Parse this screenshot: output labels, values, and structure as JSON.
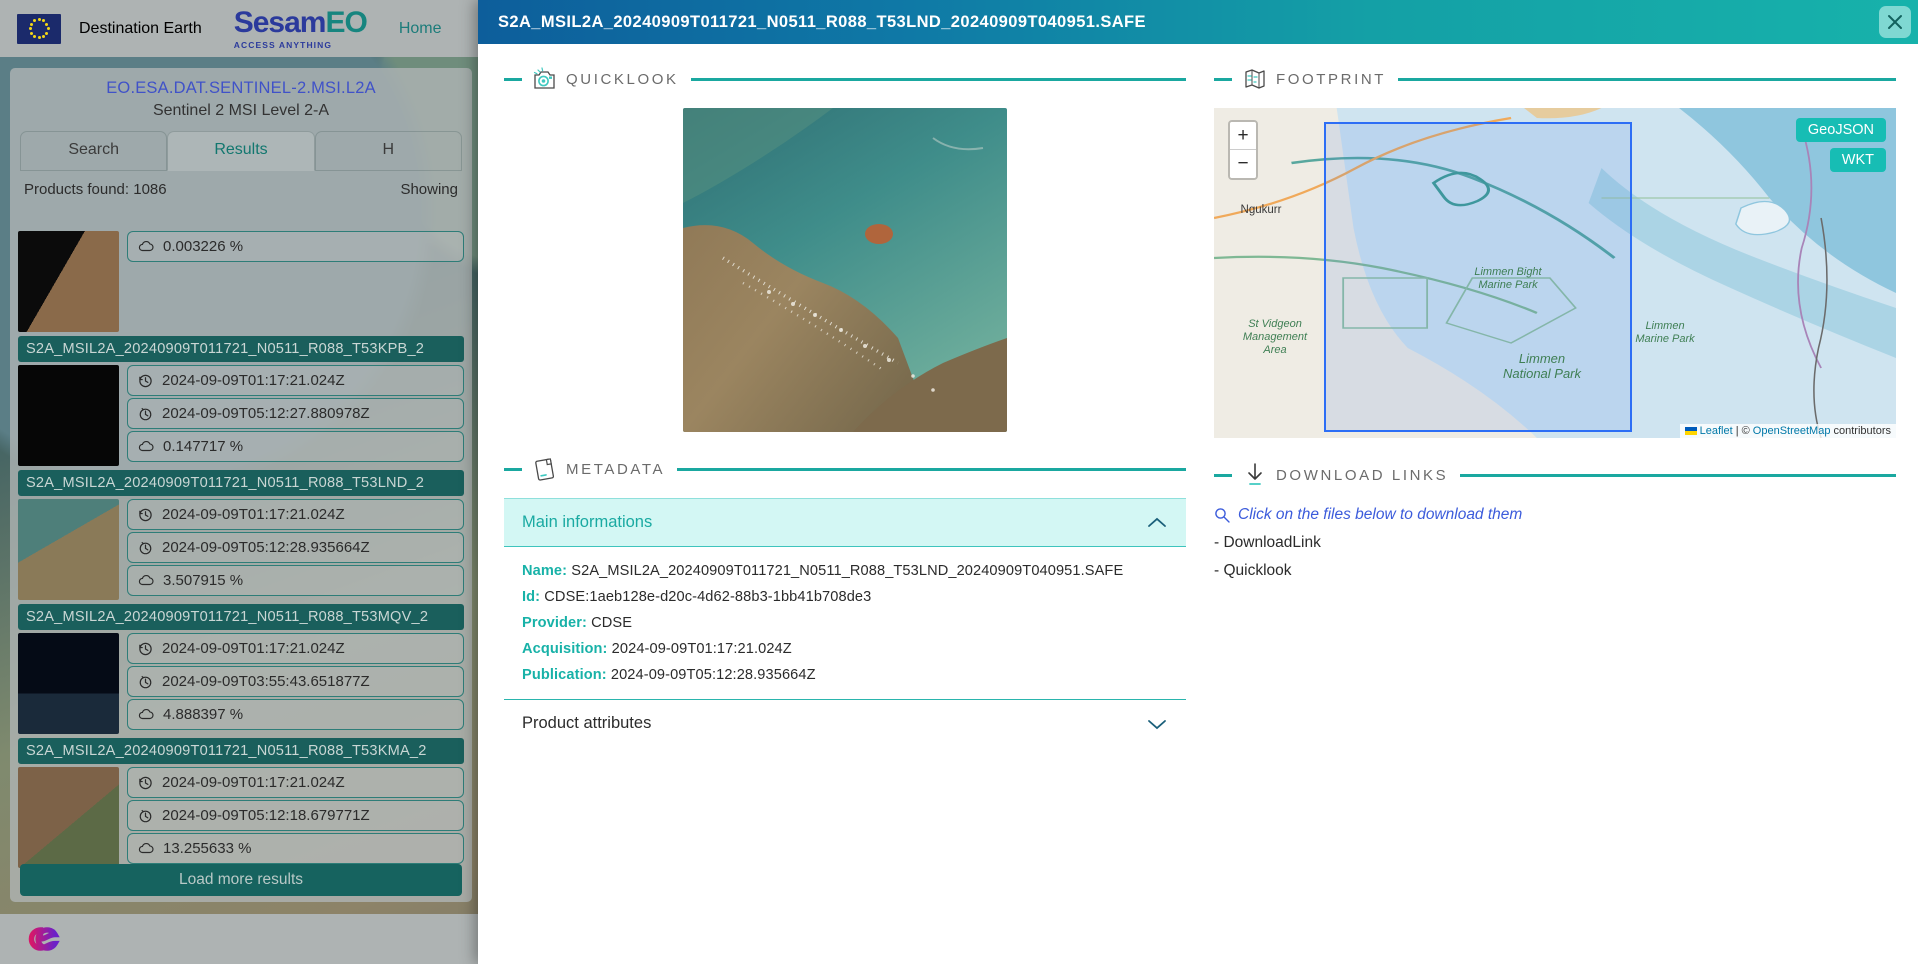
{
  "background": {
    "brand_title": "Destination Earth",
    "logo_word_a": "Sesam",
    "logo_word_b": "EO",
    "logo_tagline": "ACCESS ANYTHING",
    "nav": [
      {
        "label": "Home"
      }
    ],
    "collection_id": "EO.ESA.DAT.SENTINEL-2.MSI.L2A",
    "collection_name": "Sentinel 2 MSI Level 2-A",
    "tabs": [
      {
        "label": "Search",
        "active": false
      },
      {
        "label": "Results",
        "active": true
      },
      {
        "label": "H",
        "active": false
      }
    ],
    "products_found": "Products found: 1086",
    "showing": "Showing",
    "load_more_label": "Load more results",
    "results": [
      {
        "title": "",
        "rows": [
          {
            "icon": "cloud-icon",
            "value": "0.003226 %"
          }
        ]
      },
      {
        "title": "S2A_MSIL2A_20240909T011721_N0511_R088_T53KPB_2",
        "rows": [
          {
            "icon": "clock-back-icon",
            "value": "2024-09-09T01:17:21.024Z"
          },
          {
            "icon": "clock-icon",
            "value": "2024-09-09T05:12:27.880978Z"
          },
          {
            "icon": "cloud-icon",
            "value": "0.147717 %"
          }
        ]
      },
      {
        "title": "S2A_MSIL2A_20240909T011721_N0511_R088_T53LND_2",
        "rows": [
          {
            "icon": "clock-back-icon",
            "value": "2024-09-09T01:17:21.024Z"
          },
          {
            "icon": "clock-icon",
            "value": "2024-09-09T05:12:28.935664Z"
          },
          {
            "icon": "cloud-icon",
            "value": "3.507915 %"
          }
        ]
      },
      {
        "title": "S2A_MSIL2A_20240909T011721_N0511_R088_T53MQV_2",
        "rows": [
          {
            "icon": "clock-back-icon",
            "value": "2024-09-09T01:17:21.024Z"
          },
          {
            "icon": "clock-icon",
            "value": "2024-09-09T03:55:43.651877Z"
          },
          {
            "icon": "cloud-icon",
            "value": "4.888397 %"
          }
        ]
      },
      {
        "title": "S2A_MSIL2A_20240909T011721_N0511_R088_T53KMA_2",
        "rows": [
          {
            "icon": "clock-back-icon",
            "value": "2024-09-09T01:17:21.024Z"
          },
          {
            "icon": "clock-icon",
            "value": "2024-09-09T05:12:18.679771Z"
          },
          {
            "icon": "cloud-icon",
            "value": "13.255633 %"
          }
        ]
      }
    ]
  },
  "modal": {
    "title": "S2A_MSIL2A_20240909T011721_N0511_R088_T53LND_20240909T040951.SAFE",
    "close_icon": "close-icon",
    "quicklook": {
      "section_label": "QUICKLOOK",
      "section_icon": "camera-icon"
    },
    "footprint": {
      "section_label": "FOOTPRINT",
      "section_icon": "map-icon",
      "geojson_label": "GeoJSON",
      "wkt_label": "WKT",
      "zoom_in_label": "+",
      "zoom_out_label": "−",
      "map_labels": [
        {
          "text": "Ngukurr",
          "kind": "town"
        },
        {
          "text": "St Vidgeon Management Area",
          "kind": "area"
        },
        {
          "text": "Limmen Bight Marine Park",
          "kind": "area"
        },
        {
          "text": "Limmen National Park",
          "kind": "area"
        },
        {
          "text": "Limmen Marine Park",
          "kind": "area"
        }
      ],
      "attribution": {
        "leaflet": "Leaflet",
        "separator": "|",
        "copyright": "©",
        "osm": "OpenStreetMap",
        "contributors": "contributors"
      }
    },
    "metadata": {
      "section_label": "METADATA",
      "section_icon": "document-icon",
      "panels": [
        {
          "label": "Main informations",
          "open": true,
          "chevron": "chevron-up-icon"
        },
        {
          "label": "Product attributes",
          "open": false,
          "chevron": "chevron-down-icon"
        }
      ],
      "fields": [
        {
          "key": "Name:",
          "value": "S2A_MSIL2A_20240909T011721_N0511_R088_T53LND_20240909T040951.SAFE"
        },
        {
          "key": "Id:",
          "value": "CDSE:1aeb128e-d20c-4d62-88b3-1bb41b708de3"
        },
        {
          "key": "Provider:",
          "value": "CDSE"
        },
        {
          "key": "Acquisition:",
          "value": "2024-09-09T01:17:21.024Z"
        },
        {
          "key": "Publication:",
          "value": "2024-09-09T05:12:28.935664Z"
        }
      ]
    },
    "downloads": {
      "section_label": "DOWNLOAD LINKS",
      "section_icon": "download-arrow-icon",
      "hint": "Click on the files below to download them",
      "hint_icon": "search-icon",
      "items": [
        {
          "label": "- DownloadLink"
        },
        {
          "label": "- Quicklook"
        }
      ]
    }
  },
  "colors": {
    "accent_teal": "#1aa8a0",
    "header_blue": "#0d5e9b",
    "header_teal": "#17b2ab",
    "panel_cyan": "#d3f7f4",
    "link_blue": "#3b5bdb",
    "bbox_blue": "#2d6ef5"
  }
}
